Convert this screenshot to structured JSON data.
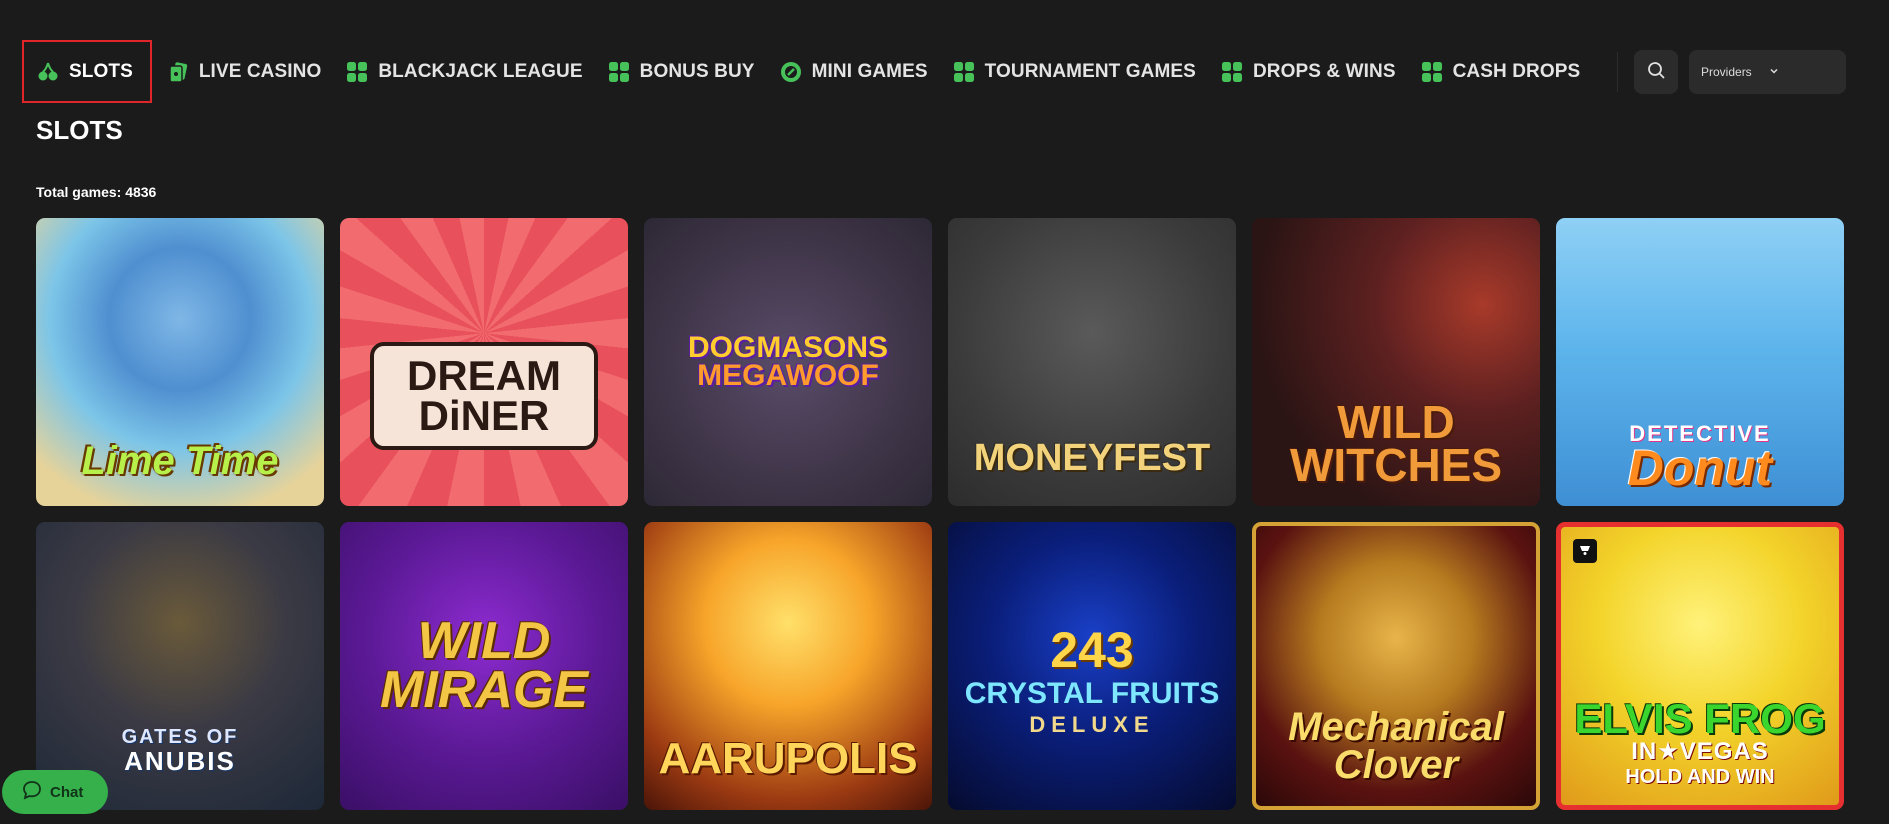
{
  "nav": {
    "items": [
      {
        "label": "SLOTS",
        "icon": "cherries-icon",
        "active": true
      },
      {
        "label": "LIVE CASINO",
        "icon": "cards-icon",
        "active": false
      },
      {
        "label": "BLACKJACK LEAGUE",
        "icon": "grid-icon",
        "active": false
      },
      {
        "label": "BONUS BUY",
        "icon": "grid-icon",
        "active": false
      },
      {
        "label": "MINI GAMES",
        "icon": "target-icon",
        "active": false
      },
      {
        "label": "TOURNAMENT GAMES",
        "icon": "grid-icon",
        "active": false
      },
      {
        "label": "DROPS & WINS",
        "icon": "grid-icon",
        "active": false
      },
      {
        "label": "CASH DROPS",
        "icon": "grid-icon",
        "active": false
      }
    ],
    "accent_color": "#47c25a",
    "active_border_color": "#e0252b"
  },
  "search": {
    "icon": "search-icon"
  },
  "providers": {
    "label": "Providers",
    "icon": "chevron-down-icon"
  },
  "page": {
    "title": "SLOTS",
    "total_games": "Total games: 4836"
  },
  "games": [
    {
      "title": "Lime Time",
      "sub": ""
    },
    {
      "title": "DREAM DiNER",
      "sub": ""
    },
    {
      "title": "DOGMASONS",
      "sub": "MEGAWOOF"
    },
    {
      "title": "MONEYFEST",
      "sub": ""
    },
    {
      "title": "WILD WITCHES",
      "sub": ""
    },
    {
      "title": "Donut",
      "sub": "DETECTIVE"
    },
    {
      "title": "GATES OF",
      "sub": "ANUBIS"
    },
    {
      "title": "WILD MIRAGE",
      "sub": ""
    },
    {
      "title": "AARUPOLIS",
      "sub": ""
    },
    {
      "title": "243",
      "sub": "CRYSTAL FRUITS",
      "sub2": "DELUXE"
    },
    {
      "title": "Mechanical Clover",
      "sub": ""
    },
    {
      "title": "ELVIS FROG",
      "sub": "IN★VEGAS",
      "sub2": "HOLD AND WIN"
    }
  ],
  "chat": {
    "label": "Chat",
    "icon": "chat-bubble-icon",
    "color": "#35b04a"
  }
}
